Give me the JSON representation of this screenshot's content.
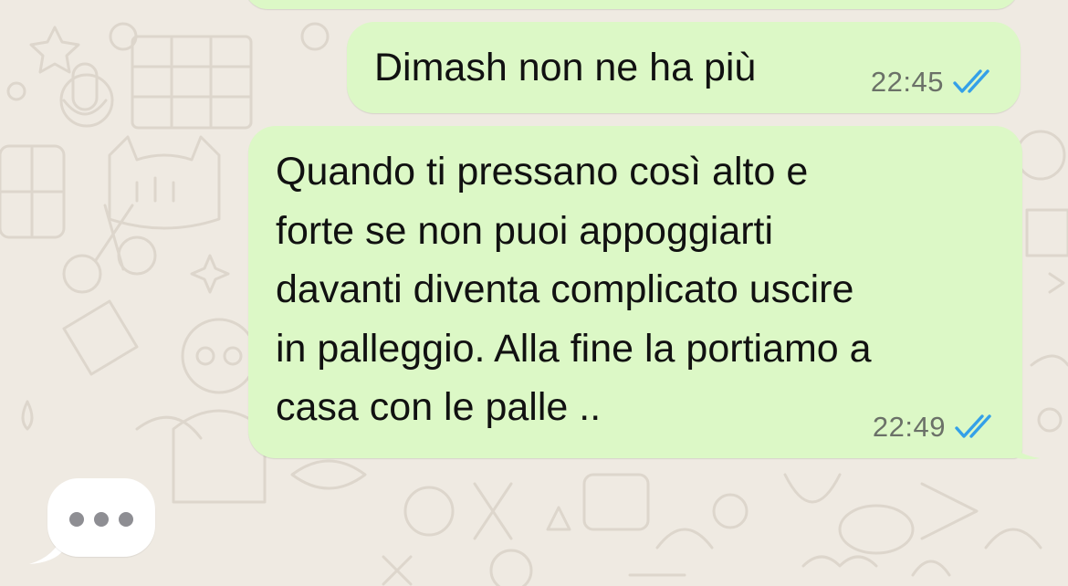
{
  "theme": {
    "wallpaper_color": "#efeae2",
    "outgoing_bubble_color": "#dcf8c6",
    "incoming_bubble_color": "#ffffff",
    "read_tick_color": "#34b7f1",
    "time_color": "#6b7168"
  },
  "messages": [
    {
      "text": "Dimash non ne ha più",
      "time": "22:45",
      "status_icon": "double-check-read-icon",
      "direction": "outgoing"
    },
    {
      "text": "Quando ti pressano così alto e\nforte se non puoi appoggiarti\ndavanti diventa complicato uscire\nin palleggio. Alla fine la portiamo a\ncasa con le palle ..",
      "time": "22:49",
      "status_icon": "double-check-read-icon",
      "direction": "outgoing"
    }
  ],
  "typing_indicator": {
    "direction": "incoming",
    "icon": "typing-dots-icon"
  }
}
